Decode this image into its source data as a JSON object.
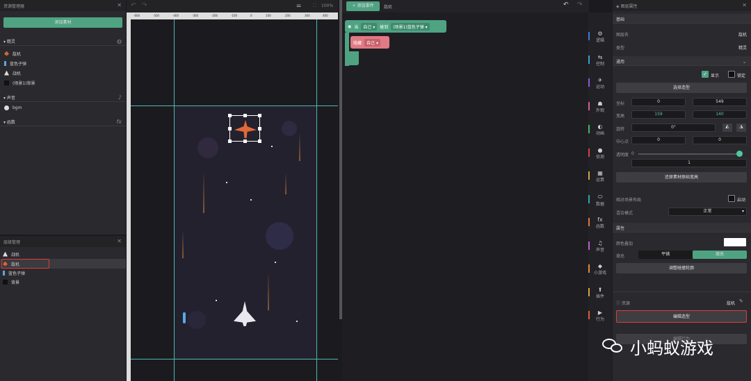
{
  "asset_panel": {
    "title": "资源管理器",
    "add_button": "添加素材",
    "sprites_section": "精灵",
    "sprites": [
      "敌机",
      "蓝色子弹",
      "战机",
      "(场景1)背景"
    ],
    "sound_section": "声音",
    "sounds": [
      "bgm"
    ],
    "func_section": "函数"
  },
  "layer_panel": {
    "title": "层级管理",
    "items": [
      "战机",
      "敌机",
      "蓝色子弹",
      "背景"
    ]
  },
  "canvas": {
    "zoom": "100%",
    "ruler": [
      "-600",
      "-500",
      "-400",
      "-300",
      "-200",
      "-100",
      "0",
      "100",
      "200",
      "300",
      "400"
    ]
  },
  "script": {
    "add_event": "添加事件",
    "target": "敌机",
    "block1": {
      "when": "当",
      "obj": "自己",
      "touch": "碰到",
      "target": "(场景1)蓝色子弹"
    },
    "block2": {
      "action": "隐藏",
      "obj": "自己"
    }
  },
  "categories": [
    {
      "label": "逻辑",
      "color": "#3b7bd6"
    },
    {
      "label": "控制",
      "color": "#3aa0c8"
    },
    {
      "label": "运动",
      "color": "#8a57d6"
    },
    {
      "label": "外观",
      "color": "#d65aa0"
    },
    {
      "label": "动画",
      "color": "#3fb86b"
    },
    {
      "label": "侦测",
      "color": "#d6423b"
    },
    {
      "label": "运算",
      "color": "#d6a23b"
    },
    {
      "label": "数据",
      "color": "#2fa6a0"
    },
    {
      "label": "函数",
      "color": "#e0763b"
    },
    {
      "label": "声音",
      "color": "#c05ad6"
    },
    {
      "label": "小游戏",
      "color": "#e08a3b"
    },
    {
      "label": "插件",
      "color": "#d6a23b"
    },
    {
      "label": "行为",
      "color": "#e05a3b"
    }
  ],
  "props": {
    "title": "图层属性",
    "basic": "基础",
    "layer_name_lbl": "图层名",
    "layer_name": "敌机",
    "type_lbl": "类型",
    "type": "精灵",
    "general": "通用",
    "show": "显示",
    "lock": "锁定",
    "choose_shape": "选择造型",
    "coord_lbl": "坐标",
    "x": "0",
    "y": "549",
    "size_lbl": "宽高",
    "w": "159",
    "h": "140",
    "rotate_lbl": "旋转",
    "rotate": "0°",
    "center_lbl": "中心点",
    "cx": "0",
    "cy": "0",
    "opacity_lbl": "透明度",
    "opacity_min": "0",
    "opacity": "1",
    "restore": "还原素材原始宽高",
    "relative_lbl": "相对场景布局",
    "relative": "启动",
    "blend_lbl": "混合模式",
    "blend": "正常",
    "attr": "属性",
    "color_add": "颜色叠加",
    "fill_lbl": "填充",
    "fill_opt1": "平铺",
    "fill_opt2": "填充",
    "contour": "调整碰撞轮廓",
    "asset_lbl": "资源",
    "asset": "敌机",
    "edit_shape": "编辑造型",
    "hidden_btn": "编辑行为"
  },
  "watermark": "小蚂蚁游戏"
}
